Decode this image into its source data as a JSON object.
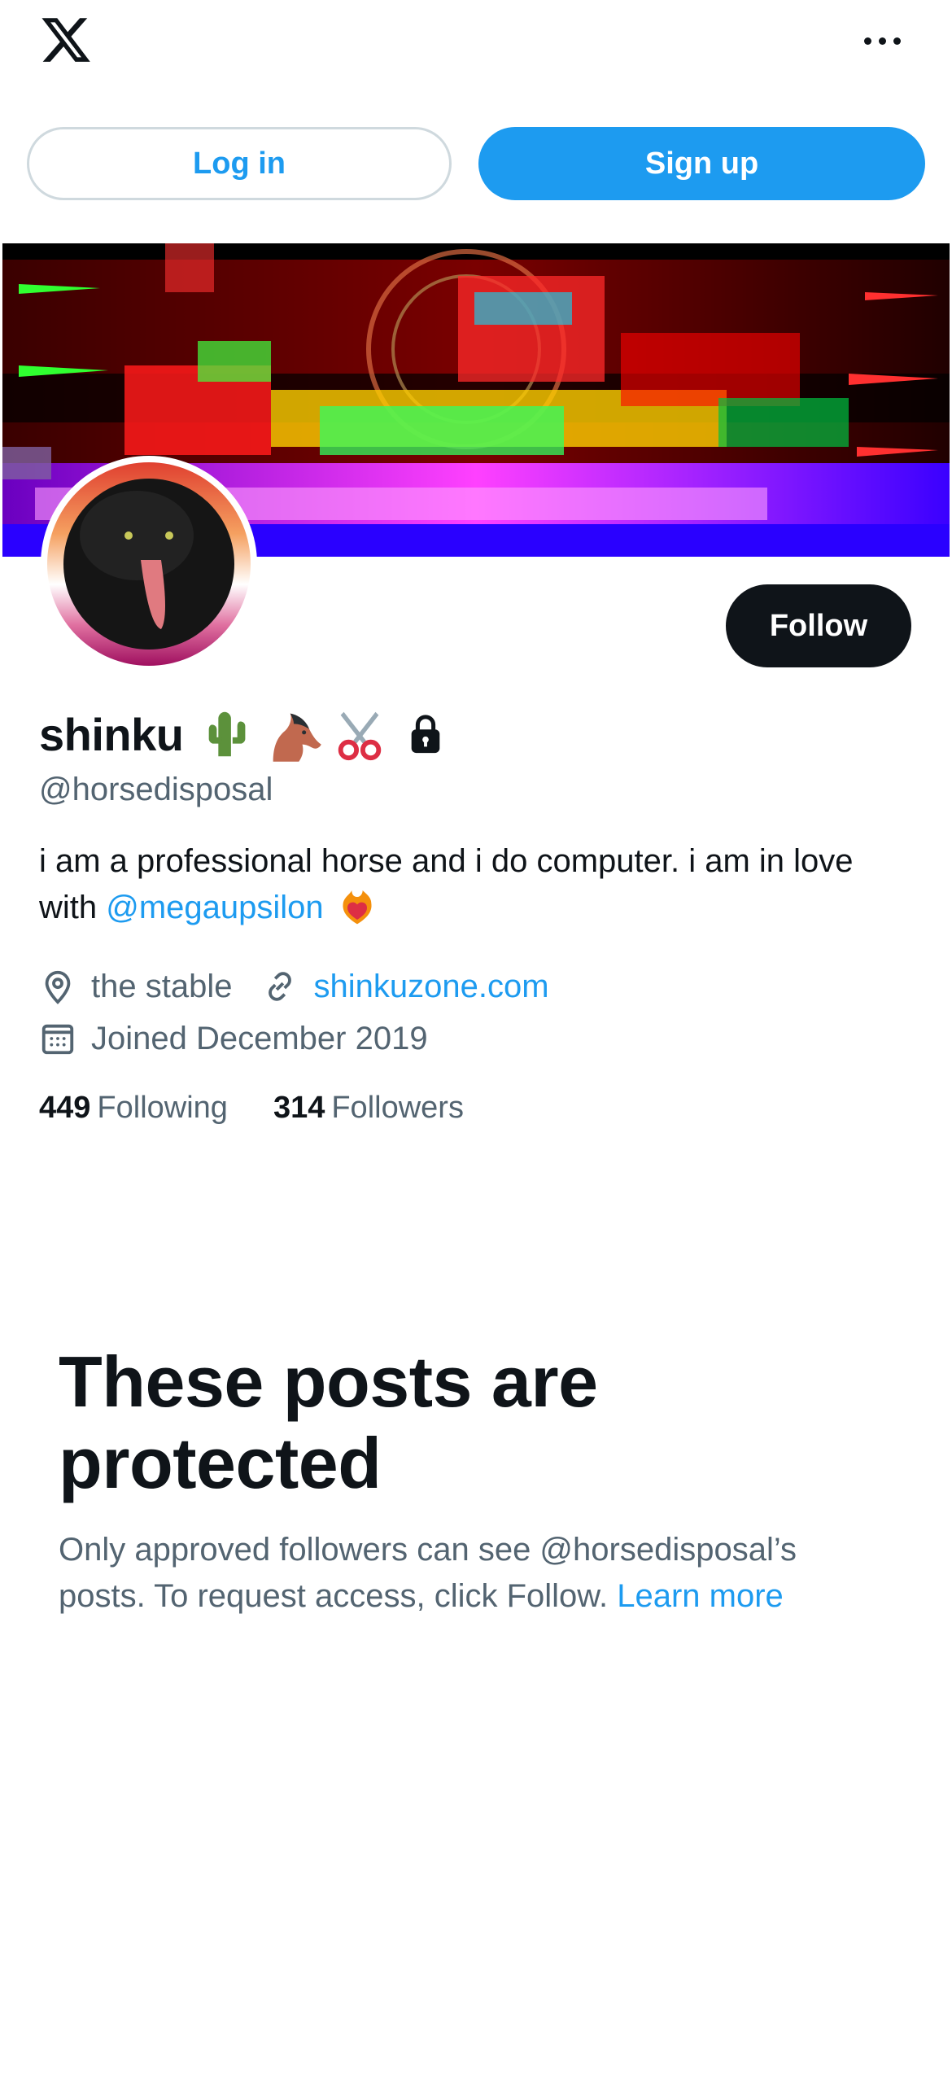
{
  "header": {
    "logo_icon": "x-logo-icon",
    "more_icon": "more-horizontal-icon"
  },
  "auth": {
    "login_label": "Log in",
    "signup_label": "Sign up"
  },
  "profile": {
    "follow_label": "Follow",
    "display_name": "shinku",
    "name_emojis": [
      "cactus-emoji",
      "horse-emoji",
      "scissors-emoji"
    ],
    "protected_icon": "lock-icon",
    "handle": "@horsedisposal",
    "bio_text": "i am a professional horse and i do computer. i am in love with ",
    "bio_mention": "@megaupsilon",
    "bio_trailing_emoji": "heart-on-fire-emoji",
    "location": "the stable",
    "location_icon": "location-pin-icon",
    "website": "shinkuzone.com",
    "website_icon": "link-icon",
    "joined": "Joined December 2019",
    "joined_icon": "calendar-icon",
    "following_count": "449",
    "following_label": "Following",
    "followers_count": "314",
    "followers_label": "Followers"
  },
  "protected": {
    "title": "These posts are protected",
    "text": "Only approved followers can see @horsedisposal’s posts. To request access, click Follow. ",
    "learn_more": "Learn more"
  },
  "colors": {
    "accent": "#1d9bf0",
    "text_primary": "#0f1419",
    "text_secondary": "#536471",
    "border": "#cfd9de"
  }
}
